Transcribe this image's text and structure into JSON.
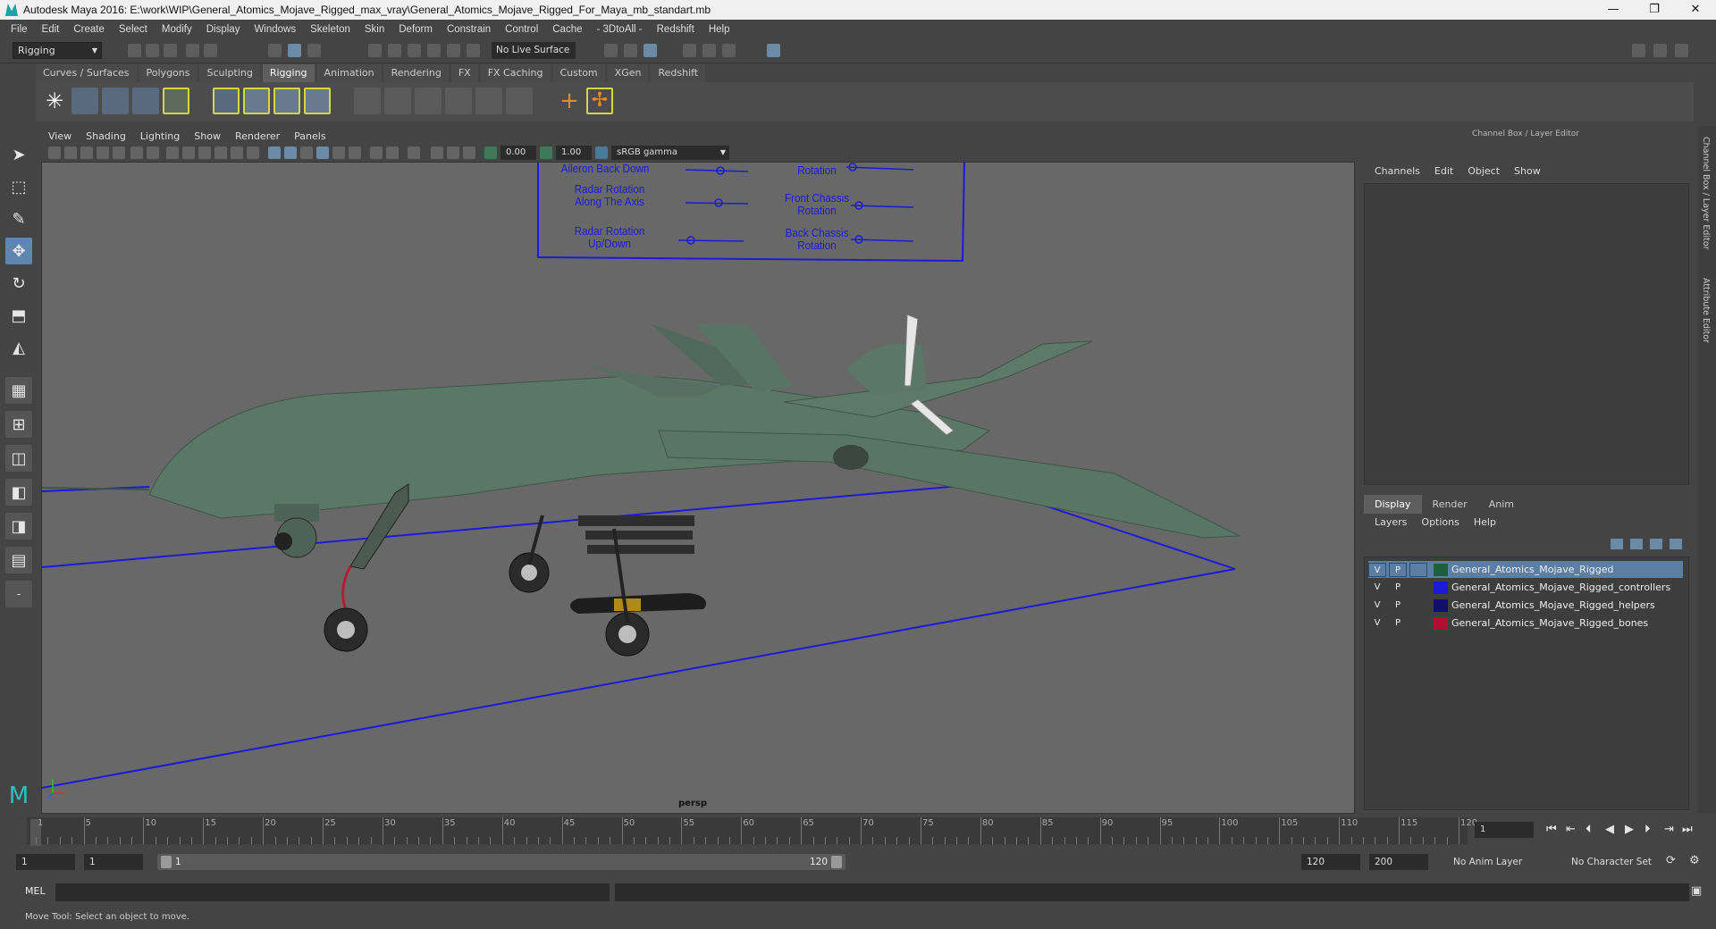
{
  "window": {
    "title": "Autodesk Maya 2016: E:\\work\\WIP\\General_Atomics_Mojave_Rigged_max_vray\\General_Atomics_Mojave_Rigged_For_Maya_mb_standart.mb",
    "minimize": "—",
    "maximize": "❐",
    "close": "✕"
  },
  "menubar": [
    "File",
    "Edit",
    "Create",
    "Select",
    "Modify",
    "Display",
    "Windows",
    "Skeleton",
    "Skin",
    "Deform",
    "Constrain",
    "Control",
    "Cache",
    "- 3DtoAll -",
    "Redshift",
    "Help"
  ],
  "statusline": {
    "mode": "Rigging",
    "live_surface": "No Live Surface"
  },
  "shelf": {
    "tabs": [
      "Curves / Surfaces",
      "Polygons",
      "Sculpting",
      "Rigging",
      "Animation",
      "Rendering",
      "FX",
      "FX Caching",
      "Custom",
      "XGen",
      "Redshift"
    ],
    "active_tab": "Rigging"
  },
  "viewport": {
    "menu": [
      "View",
      "Shading",
      "Lighting",
      "Show",
      "Renderer",
      "Panels"
    ],
    "exposure": "0.00",
    "gamma": "1.00",
    "color_space": "sRGB gamma",
    "camera": "persp",
    "overlay_labels": {
      "aileron": "Aileron Back Down",
      "radar_axis": "Radar Rotation\nAlong The Axis",
      "radar_updown": "Radar Rotation\nUp/Down",
      "top_right": "Back Wheels\nRotation",
      "front_chassis": "Front Chassis\nRotation",
      "back_chassis": "Back Chassis\nRotation"
    }
  },
  "channel_box": {
    "title": "Channel Box / Layer Editor",
    "menu": [
      "Channels",
      "Edit",
      "Object",
      "Show"
    ]
  },
  "layer_editor": {
    "tabs": [
      "Display",
      "Render",
      "Anim"
    ],
    "active_tab": "Display",
    "menu": [
      "Layers",
      "Options",
      "Help"
    ],
    "layers": [
      {
        "v": "V",
        "p": "P",
        "name": "General_Atomics_Mojave_Rigged",
        "color": "#1f5e3c",
        "selected": true
      },
      {
        "v": "V",
        "p": "P",
        "name": "General_Atomics_Mojave_Rigged_controllers",
        "color": "#1b1bd6",
        "selected": false
      },
      {
        "v": "V",
        "p": "P",
        "name": "General_Atomics_Mojave_Rigged_helpers",
        "color": "#10106a",
        "selected": false
      },
      {
        "v": "V",
        "p": "P",
        "name": "General_Atomics_Mojave_Rigged_bones",
        "color": "#b01030",
        "selected": false
      }
    ]
  },
  "side_tabs": [
    "Channel Box / Layer Editor",
    "Attribute Editor"
  ],
  "timeline": {
    "start": 1,
    "end": 120,
    "current": 1,
    "current_field": "1",
    "tick_labels": [
      "1",
      "5",
      "10",
      "15",
      "20",
      "25",
      "30",
      "35",
      "40",
      "45",
      "50",
      "55",
      "60",
      "65",
      "70",
      "75",
      "80",
      "85",
      "90",
      "95",
      "100",
      "105",
      "110",
      "115",
      "120"
    ]
  },
  "range": {
    "start_field": "1",
    "playback_start": "1",
    "slider_start": "1",
    "slider_end": "120",
    "playback_end": "120",
    "end_field": "200",
    "anim_layer": "No Anim Layer",
    "character_set": "No Character Set"
  },
  "command_line": {
    "label": "MEL"
  },
  "help_line": "Move Tool: Select an object to move.",
  "colors": {
    "accent": "#5f86b0",
    "controller_blue": "#1b1bd6",
    "drone_body": "#5d7a6a"
  }
}
